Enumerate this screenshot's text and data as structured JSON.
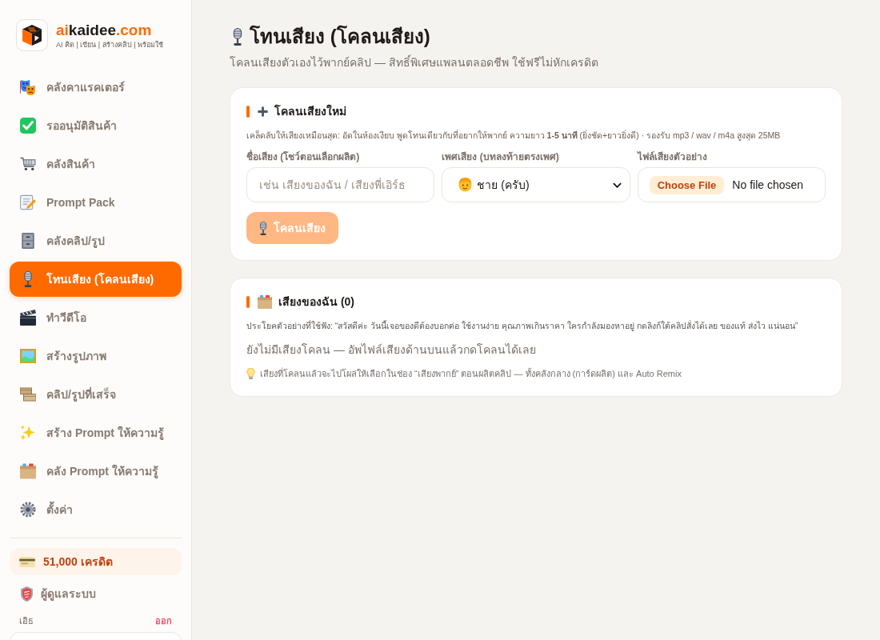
{
  "sidebar": {
    "brand": {
      "parts": [
        {
          "text": "ai",
          "accent": true
        },
        {
          "text": "kaidee",
          "accent": false
        },
        {
          "text": ".com",
          "accent": true
        }
      ],
      "tagline": "AI คิด | เขียน | สร้างคลิป | พร้อมใช้"
    },
    "items": [
      {
        "label": "คลังคาแรคเตอร์",
        "selected": false
      },
      {
        "label": "รออนุมัติสินค้า",
        "selected": false
      },
      {
        "label": "คลังสินค้า",
        "selected": false
      },
      {
        "label": "Prompt Pack",
        "selected": false
      },
      {
        "label": "คลังคลิป/รูป",
        "selected": false
      },
      {
        "label": "โทนเสียง (โคลนเสียง)",
        "selected": true
      },
      {
        "label": "ทำวีดีโอ",
        "selected": false
      },
      {
        "label": "สร้างรูปภาพ",
        "selected": false
      },
      {
        "label": "คลิป/รูปที่เสร็จ",
        "selected": false
      },
      {
        "label": "สร้าง Prompt ให้ความรู้",
        "selected": false
      },
      {
        "label": "คลัง Prompt ให้ความรู้",
        "selected": false
      },
      {
        "label": "ตั้งค่า",
        "selected": false
      }
    ],
    "credits": "51,000 เครดิต",
    "admin_link": "ผู้ดูแลระบบ",
    "user": {
      "name": "เอิธ",
      "logout": "ออก"
    }
  },
  "page": {
    "title": "โทนเสียง (โคลนเสียง)",
    "subtitle": "โคลนเสียงตัวเองไว้พากย์คลิป — สิทธิ์พิเศษแพลนตลอดชีพ ใช้ฟรีไม่หักเครดิต"
  },
  "new_voice_card": {
    "title": "โคลนเสียงใหม่",
    "tip": "เคล็ดลับให้เสียงเหมือนสุด: อัดในห้องเงียบ พูดโทนเดียวกับที่อยากให้พากย์ ความยาว **1-5 นาที** (ยิ่งชัด+ยาวยิ่งดี) · รองรับ mp3 / wav / m4a สูงสุด 25MB",
    "fields": [
      {
        "kind": "text",
        "label": "ชื่อเสียง (โชว์ตอนเลือกผลิต)",
        "placeholder": "เช่น เสียงของฉัน / เสียงพี่เอิร์ธ"
      },
      {
        "kind": "select",
        "label": "เพศเสียง (บทลงท้ายตรงเพศ)",
        "value": "ชาย (ครับ)"
      },
      {
        "kind": "file",
        "label": "ไฟล์เสียงตัวอย่าง",
        "button": "Choose File",
        "status": "No file chosen"
      }
    ],
    "submit": {
      "label": "โคลนเสียง",
      "disabled": true
    }
  },
  "my_voices_card": {
    "title": "เสียงของฉัน (0)",
    "sample": "ประโยคตัวอย่างที่ใช้ฟัง: “สวัสดีค่ะ วันนี้เจอของดีต้องบอกต่อ ใช้งานง่าย คุณภาพเกินราคา ใครกำลังมองหาอยู่ กดลิงก์ใต้คลิปสั่งได้เลย ของแท้ ส่งไว แน่นอน”",
    "empty": "ยังไม่มีเสียงโคลน — อัพไฟล์เสียงด้านบนแล้วกดโคลนได้เลย",
    "hint": "เสียงที่โคลนแล้วจะไปโผล่ให้เลือกในช่อง “เสียงพากย์” ตอนผลิตคลิป — ทั้งคลังกลาง (การ์ดผลิต) และ Auto Remix"
  }
}
